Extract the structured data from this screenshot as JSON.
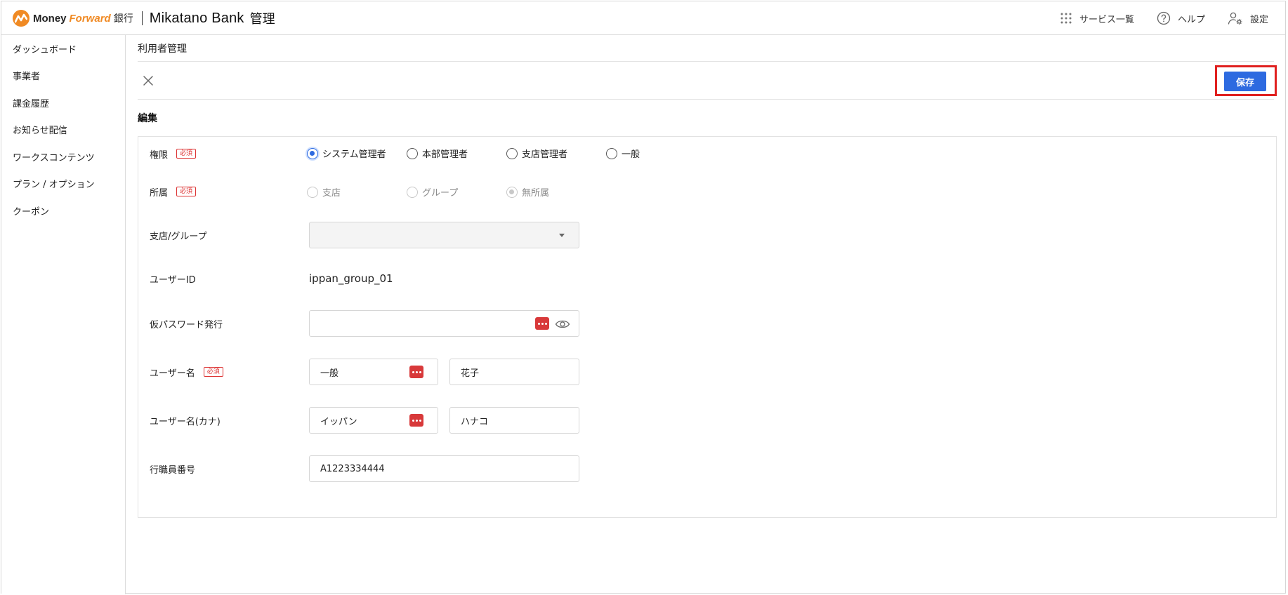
{
  "header": {
    "brand_money": "Money",
    "brand_forward": "Forward",
    "brand_bank_jp": "銀行",
    "brand_mikatano": "Mikatano",
    "brand_bank": " Bank",
    "brand_kanri": "管理",
    "services_label": "サービス一覧",
    "help_label": "ヘルプ",
    "settings_label": "設定"
  },
  "sidebar": {
    "items": [
      {
        "label": "ダッシュボード"
      },
      {
        "label": "事業者"
      },
      {
        "label": "課金履歴"
      },
      {
        "label": "お知らせ配信"
      },
      {
        "label": "ワークスコンテンツ"
      },
      {
        "label": "プラン / オプション"
      },
      {
        "label": "クーポン"
      }
    ]
  },
  "main": {
    "page_title": "利用者管理",
    "save_label": "保存",
    "section_title": "編集",
    "required_badge": "必須"
  },
  "form": {
    "role": {
      "label": "権限",
      "options": [
        "システム管理者",
        "本部管理者",
        "支店管理者",
        "一般"
      ],
      "selected": "システム管理者"
    },
    "affiliation": {
      "label": "所属",
      "options": [
        "支店",
        "グループ",
        "無所属"
      ],
      "selected": "無所属",
      "disabled": true
    },
    "branch_group": {
      "label": "支店/グループ",
      "value": ""
    },
    "user_id": {
      "label": "ユーザーID",
      "value": "ippan_group_01"
    },
    "temp_password": {
      "label": "仮パスワード発行",
      "value": ""
    },
    "user_name": {
      "label": "ユーザー名",
      "last": "一般",
      "first": "花子"
    },
    "user_name_kana": {
      "label": "ユーザー名(カナ)",
      "last": "イッパン",
      "first": "ハナコ"
    },
    "staff_number": {
      "label": "行職員番号",
      "value": "A1223334444"
    }
  },
  "colors": {
    "primary": "#2d6ae0",
    "required": "#dd3333",
    "brand_orange": "#f08a24",
    "highlight_box": "#e0201f",
    "pw_icon": "#d8393a"
  }
}
